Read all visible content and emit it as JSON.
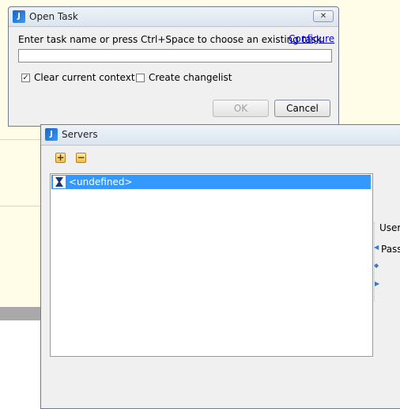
{
  "open_task": {
    "title": "Open Task",
    "prompt": "Enter task name or press Ctrl+Space to choose an existing task:",
    "configure_link": "Configure",
    "task_value": "",
    "clear_context_label": "Clear current context",
    "clear_context_checked": true,
    "create_changelist_label": "Create changelist",
    "create_changelist_checked": false,
    "ok_label": "OK",
    "cancel_label": "Cancel",
    "close_glyph": "✕"
  },
  "servers": {
    "title": "Servers",
    "add_glyph": "+",
    "remove_glyph": "−",
    "items": [
      {
        "label": "<undefined>",
        "selected": true
      }
    ],
    "username_label": "Userna",
    "password_label": "Passw"
  },
  "colors": {
    "selection": "#3399ff",
    "link": "#0000dd",
    "background_panel": "#fffde8"
  },
  "icons": {
    "app": "intellij-icon",
    "server": "server-icon",
    "add": "add-icon",
    "remove": "remove-icon"
  }
}
